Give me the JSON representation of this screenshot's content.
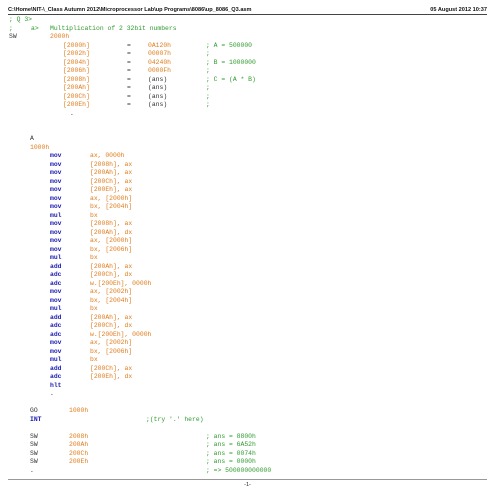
{
  "header": {
    "path": "C:\\Home\\NIT-\\_Class Autumn 2012\\Microprocessor Lab\\up Programs\\8086\\up_8086_Q3.asm",
    "date": "05 August 2012 10:37"
  },
  "footer": {
    "page": "-1-"
  },
  "code": {
    "l01": "; Q 3>",
    "l02a": ";",
    "l02b": "a>",
    "l02c": "Multiplication of 2 32bit numbers",
    "l03a": "SW",
    "l03b": "2000h",
    "data": [
      {
        "addr": "[2000h]",
        "eq": "=",
        "val": "0A120h",
        "com": "; A = 500000"
      },
      {
        "addr": "[2002h]",
        "eq": "=",
        "val": "00007h",
        "com": ";"
      },
      {
        "addr": "[2004h]",
        "eq": "=",
        "val": "04240h",
        "com": "; B = 1000000"
      },
      {
        "addr": "[2006h]",
        "eq": "=",
        "val": "0000Fh",
        "com": ";"
      },
      {
        "addr": "[2008h]",
        "eq": "=",
        "val": "(ans)",
        "com": "; C = (A * B)"
      },
      {
        "addr": "[200Ah]",
        "eq": "=",
        "val": "(ans)",
        "com": ";"
      },
      {
        "addr": "[200Ch]",
        "eq": "=",
        "val": "(ans)",
        "com": ";"
      },
      {
        "addr": "[200Eh]",
        "eq": "=",
        "val": "(ans)",
        "com": ";"
      }
    ],
    "dot1": ".",
    "a_label": "A",
    "org": "1000h",
    "instr": [
      {
        "m": "mov",
        "o": "ax, 0000h"
      },
      {
        "m": "mov",
        "o": "[2008h], ax"
      },
      {
        "m": "mov",
        "o": "[200Ah], ax"
      },
      {
        "m": "mov",
        "o": "[200Ch], ax"
      },
      {
        "m": "mov",
        "o": "[200Eh], ax"
      },
      {
        "m": "mov",
        "o": "ax, [2000h]"
      },
      {
        "m": "mov",
        "o": "bx, [2004h]"
      },
      {
        "m": "mul",
        "o": "bx"
      },
      {
        "m": "mov",
        "o": "[2008h], ax"
      },
      {
        "m": "mov",
        "o": "[200Ah], dx"
      },
      {
        "m": "mov",
        "o": "ax, [2000h]"
      },
      {
        "m": "mov",
        "o": "bx, [2006h]"
      },
      {
        "m": "mul",
        "o": "bx"
      },
      {
        "m": "add",
        "o": "[200Ah], ax"
      },
      {
        "m": "adc",
        "o": "[200Ch], dx"
      },
      {
        "m": "adc",
        "o": "w.[200Eh], 0000h"
      },
      {
        "m": "mov",
        "o": "ax, [2002h]"
      },
      {
        "m": "mov",
        "o": "bx, [2004h]"
      },
      {
        "m": "mul",
        "o": "bx"
      },
      {
        "m": "add",
        "o": "[200Ah], ax"
      },
      {
        "m": "adc",
        "o": "[200Ch], dx"
      },
      {
        "m": "adc",
        "o": "w.[200Eh], 0000h"
      },
      {
        "m": "mov",
        "o": "ax, [2002h]"
      },
      {
        "m": "mov",
        "o": "bx, [2006h]"
      },
      {
        "m": "mul",
        "o": "bx"
      },
      {
        "m": "add",
        "o": "[200Ch], ax"
      },
      {
        "m": "adc",
        "o": "[200Eh], dx"
      },
      {
        "m": "hlt",
        "o": ""
      }
    ],
    "dot2": ".",
    "go_kw": "GO",
    "go_val": "1000h",
    "int_kw": "INT",
    "int_com": ";(try '.' here)",
    "sw_rows": [
      {
        "kw": "SW",
        "addr": "2008h",
        "com": "; ans = 8800h"
      },
      {
        "kw": "SW",
        "addr": "200Ah",
        "com": "; ans = 6A52h"
      },
      {
        "kw": "SW",
        "addr": "200Ch",
        "com": "; ans = 0074h"
      },
      {
        "kw": "SW",
        "addr": "200Eh",
        "com": "; ans = 0000h"
      }
    ],
    "last_dot": ".",
    "last_com": "; => 500000000000"
  }
}
